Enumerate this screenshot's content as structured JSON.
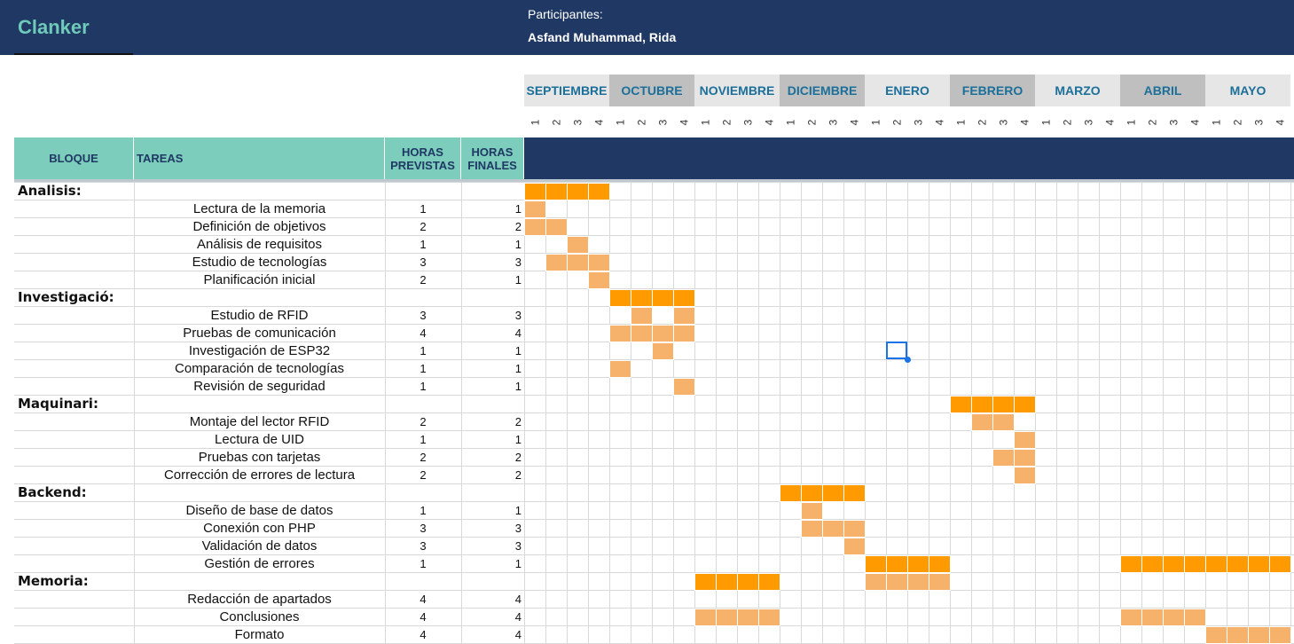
{
  "app": {
    "title": "Clanker",
    "participants_label": "Participantes:",
    "participants": "Asfand Muhammad, Rida"
  },
  "colors": {
    "header": "#1f3864",
    "accent": "#7ccdbc",
    "block_bar": "#ff9a00",
    "task_bar": "#f6b26b"
  },
  "months": [
    "SEPTIEMBRE",
    "OCTUBRE",
    "NOVIEMBRE",
    "DICIEMBRE",
    "ENERO",
    "FEBRERO",
    "MARZO",
    "ABRIL",
    "MAYO"
  ],
  "week_labels": [
    "1",
    "2",
    "3",
    "4"
  ],
  "columns": {
    "bloque": "BLOQUE",
    "tareas": "TAREAS",
    "horas_previstas": "HORAS PREVISTAS",
    "horas_finales": "HORAS FINALES"
  },
  "rows": [
    {
      "type": "block",
      "name": "Analisis:",
      "weeks": [
        0,
        1,
        2,
        3
      ]
    },
    {
      "type": "task",
      "name": "Lectura de la memoria",
      "prev": "1",
      "fin": "1",
      "weeks": [
        0
      ]
    },
    {
      "type": "task",
      "name": "Definición de objetivos",
      "prev": "2",
      "fin": "2",
      "weeks": [
        0,
        1
      ]
    },
    {
      "type": "task",
      "name": "Análisis de requisitos",
      "prev": "1",
      "fin": "1",
      "weeks": [
        2
      ]
    },
    {
      "type": "task",
      "name": "Estudio de tecnologías",
      "prev": "3",
      "fin": "3",
      "weeks": [
        1,
        2,
        3
      ]
    },
    {
      "type": "task",
      "name": "Planificación inicial",
      "prev": "2",
      "fin": "1",
      "weeks": [
        3
      ]
    },
    {
      "type": "block",
      "name": "Investigació:",
      "weeks": [
        4,
        5,
        6,
        7
      ]
    },
    {
      "type": "task",
      "name": "Estudio de RFID",
      "prev": "3",
      "fin": "3",
      "weeks": [
        5,
        7
      ]
    },
    {
      "type": "task",
      "name": "Pruebas de comunicación",
      "prev": "4",
      "fin": "4",
      "weeks": [
        4,
        5,
        6,
        7
      ]
    },
    {
      "type": "task",
      "name": "Investigación de ESP32",
      "prev": "1",
      "fin": "1",
      "weeks": [
        6
      ]
    },
    {
      "type": "task",
      "name": "Comparación de tecnologías",
      "prev": "1",
      "fin": "1",
      "weeks": [
        4
      ]
    },
    {
      "type": "task",
      "name": "Revisión de seguridad",
      "prev": "1",
      "fin": "1",
      "weeks": [
        7
      ]
    },
    {
      "type": "block",
      "name": "Maquinari:",
      "weeks": [
        20,
        21,
        22,
        23
      ]
    },
    {
      "type": "task",
      "name": "Montaje del lector RFID",
      "prev": "2",
      "fin": "2",
      "weeks": [
        21,
        22
      ]
    },
    {
      "type": "task",
      "name": "Lectura de UID",
      "prev": "1",
      "fin": "1",
      "weeks": [
        23
      ]
    },
    {
      "type": "task",
      "name": "Pruebas con tarjetas",
      "prev": "2",
      "fin": "2",
      "weeks": [
        22,
        23
      ]
    },
    {
      "type": "task",
      "name": "Corrección de errores de lectura",
      "prev": "2",
      "fin": "2",
      "weeks": [
        23
      ]
    },
    {
      "type": "block",
      "name": "Backend:",
      "weeks": [
        12,
        13,
        14,
        15
      ]
    },
    {
      "type": "task",
      "name": "Diseño de base de datos",
      "prev": "1",
      "fin": "1",
      "weeks": [
        13
      ]
    },
    {
      "type": "task",
      "name": "Conexión con PHP",
      "prev": "3",
      "fin": "3",
      "weeks": [
        13,
        14,
        15
      ]
    },
    {
      "type": "task",
      "name": "Validación de datos",
      "prev": "3",
      "fin": "3",
      "weeks": [
        15
      ]
    },
    {
      "type": "task",
      "name": "Gestión de errores",
      "prev": "1",
      "fin": "1",
      "weeks": [
        16,
        17,
        18,
        19,
        28,
        29,
        30,
        31,
        32,
        33,
        34,
        35
      ],
      "block_style": true
    },
    {
      "type": "block",
      "name": "Memoria:",
      "weeks": [
        8,
        9,
        10,
        11,
        16,
        17,
        18,
        19
      ],
      "mixed": [
        16,
        17,
        18,
        19
      ]
    },
    {
      "type": "task",
      "name": "Redacción de apartados",
      "prev": "4",
      "fin": "4",
      "weeks": []
    },
    {
      "type": "task",
      "name": "Conclusiones",
      "prev": "4",
      "fin": "4",
      "weeks": [
        8,
        9,
        10,
        11,
        28,
        29,
        30,
        31
      ]
    },
    {
      "type": "task",
      "name": "Formato",
      "prev": "4",
      "fin": "4",
      "weeks": [
        32,
        33,
        34,
        35
      ]
    }
  ]
}
